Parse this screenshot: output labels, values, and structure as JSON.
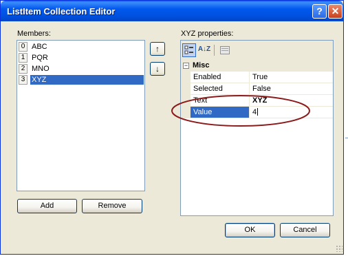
{
  "window": {
    "title": "ListItem Collection Editor",
    "help_glyph": "?",
    "close_glyph": "✕"
  },
  "members": {
    "label": "Members:",
    "items": [
      {
        "index": "0",
        "name": "ABC",
        "selected": false
      },
      {
        "index": "1",
        "name": "PQR",
        "selected": false
      },
      {
        "index": "2",
        "name": "MNO",
        "selected": false
      },
      {
        "index": "3",
        "name": "XYZ",
        "selected": true
      }
    ],
    "move_up_glyph": "↑",
    "move_down_glyph": "↓",
    "add_label": "Add",
    "remove_label": "Remove"
  },
  "properties": {
    "label": "XYZ properties:",
    "toolbar": {
      "categorized_icon": "categorized-icon",
      "alphabetical_icon": "alphabetical-icon",
      "alphabetical_glyph": "A↓Z",
      "property_pages_icon": "property-pages-icon"
    },
    "category": {
      "name": "Misc",
      "toggle": "−"
    },
    "rows": [
      {
        "name": "Enabled",
        "value": "True"
      },
      {
        "name": "Selected",
        "value": "False"
      },
      {
        "name": "Text",
        "value": "XYZ"
      },
      {
        "name": "Value",
        "value": "4"
      }
    ]
  },
  "dialog_buttons": {
    "ok_label": "OK",
    "cancel_label": "Cancel"
  },
  "colors": {
    "titlebar": "#0054e3",
    "selection": "#316ac5",
    "annotation": "#8b1a1a"
  }
}
